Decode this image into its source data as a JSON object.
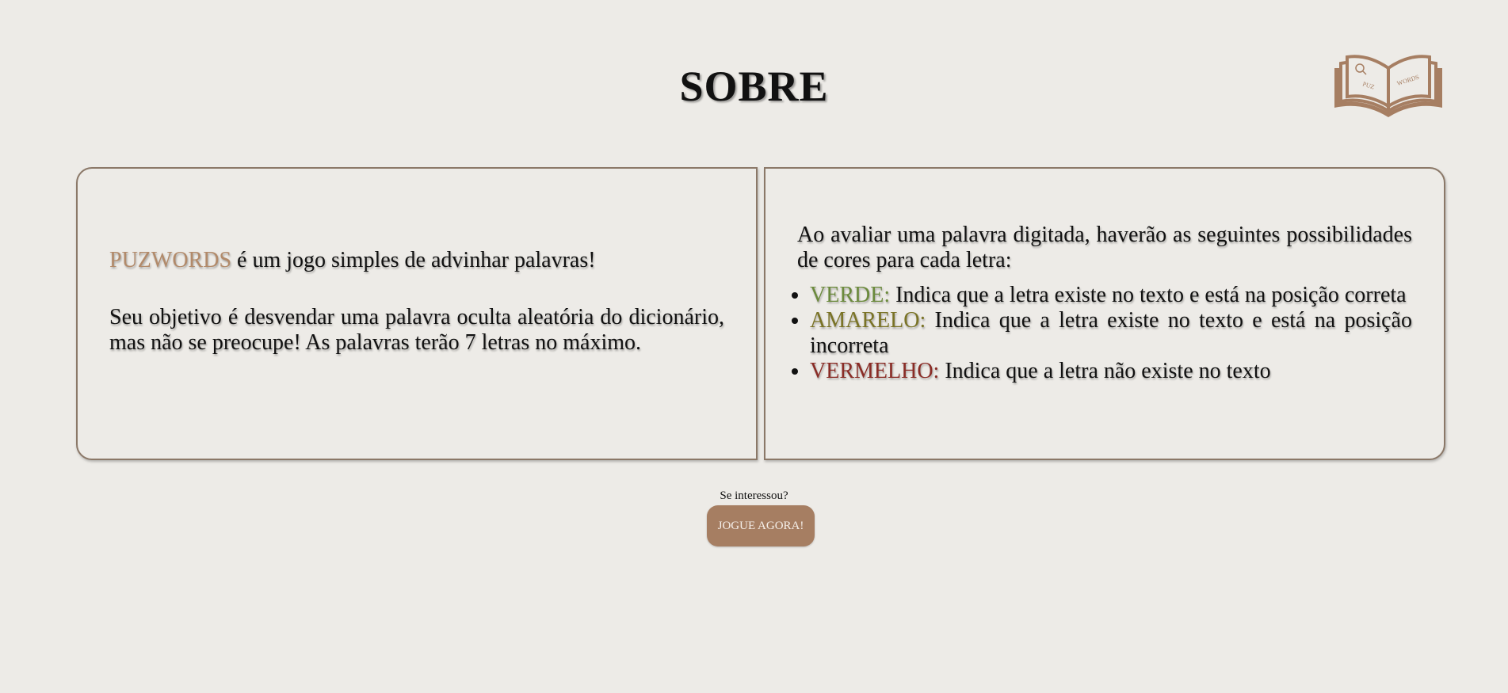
{
  "header": {
    "title": "SOBRE",
    "logo": {
      "icon": "open-book-logo-icon",
      "left_text": "PUZ",
      "right_text": "WORDS"
    }
  },
  "intro_panel": {
    "brand": "PUZWORDS",
    "line1_rest": " é um jogo simples de advinhar palavras!",
    "paragraph2": "Seu objetivo é desvendar uma palavra oculta aleatória do dicionário, mas não se preocupe! As palavras terão 7 letras no máximo."
  },
  "rules_panel": {
    "intro": "Ao avaliar uma palavra digitada, haverão as seguintes possibilidades de cores para cada letra:",
    "items": [
      {
        "color_label": "VERDE:",
        "description": " Indica que a letra existe no texto e está na posição correta"
      },
      {
        "color_label": "AMARELO:",
        "description": " Indica que a letra existe no texto e está na posição incorreta"
      },
      {
        "color_label": "VERMELHO:",
        "description": " Indica que a letra não existe no texto"
      }
    ]
  },
  "cta": {
    "prompt": "Se interessou?",
    "button_label": "JOGUE AGORA!"
  },
  "colors": {
    "background": "#edebe7",
    "brand": "#b28a6a",
    "green": "#6b8a3c",
    "yellow": "#7a7326",
    "red": "#8a2c26",
    "button": "#a67e62",
    "border": "#8b7868"
  }
}
